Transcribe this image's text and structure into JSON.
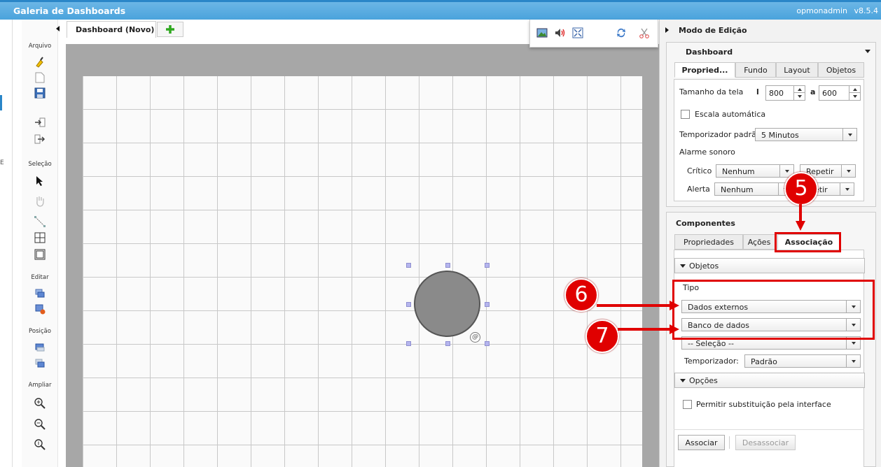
{
  "topbar": {
    "title": "Galeria de Dashboards",
    "user": "opmonadmin",
    "version": "v8.5.4"
  },
  "farleft": {
    "glyph": "E"
  },
  "toolbox": {
    "sections": {
      "arquivo": "Arquivo",
      "selecao": "Seleção",
      "editar": "Editar",
      "posicao": "Posição",
      "ampliar": "Ampliar"
    }
  },
  "tabs": {
    "doc_tab": "Dashboard (Novo)",
    "add_symbol": "+"
  },
  "canvas": {
    "at_symbol": "@"
  },
  "right_panel": {
    "header": "Modo de Edição",
    "dashboard": {
      "title": "Dashboard",
      "tabs": [
        "Propried...",
        "Fundo",
        "Layout",
        "Objetos"
      ],
      "screen_size_label": "Tamanho da tela",
      "l_symbol": "l",
      "width": "800",
      "a_symbol": "a",
      "height": "600",
      "auto_scale_label": "Escala automática",
      "timer_label": "Temporizador padrão",
      "timer_value": "5 Minutos",
      "alarm_label": "Alarme sonoro",
      "critico_label": "Crítico",
      "critico_value": "Nenhum",
      "critico_repeat": "Repetir",
      "alerta_label": "Alerta",
      "alerta_value": "Nenhum",
      "alerta_repeat": "etir"
    },
    "componentes": {
      "title": "Componentes",
      "tabs": [
        "Propriedades",
        "Ações",
        "Associação"
      ],
      "objetos_section": "Objetos",
      "tipo_label": "Tipo",
      "tipo_value": "Dados externos",
      "source_value": "Banco de dados",
      "selection_value": "-- Seleção --",
      "timer_label": "Temporizador:",
      "timer_value": "Padrão",
      "opcoes_section": "Opções",
      "allow_label": "Permitir substituição pela interface",
      "associate_button": "Associar",
      "disassociate_button": "Desassociar"
    }
  },
  "annotations": {
    "badge5": "5",
    "badge6": "6",
    "badge7": "7",
    "color": "#e00000"
  }
}
